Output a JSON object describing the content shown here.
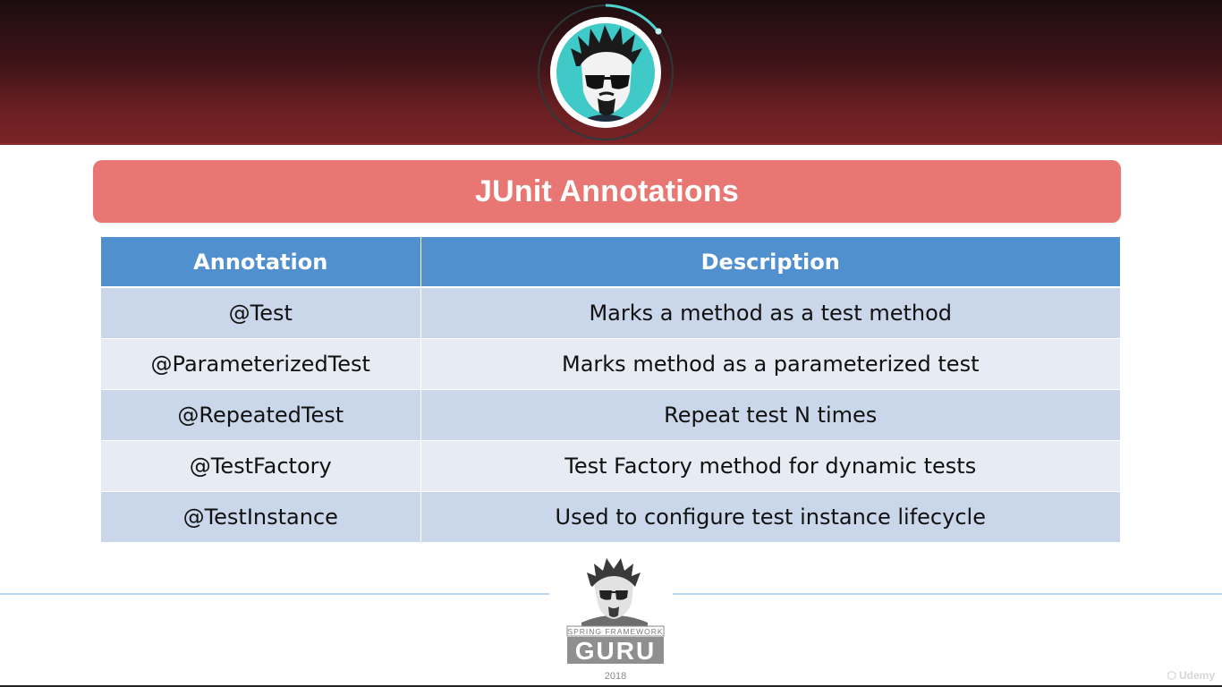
{
  "slide": {
    "title": "JUnit Annotations"
  },
  "table": {
    "headers": [
      "Annotation",
      "Description"
    ],
    "rows": [
      {
        "annotation": "@Test",
        "description": "Marks a method as a test method"
      },
      {
        "annotation": "@ParameterizedTest",
        "description": "Marks method as a parameterized test"
      },
      {
        "annotation": "@RepeatedTest",
        "description": "Repeat test N times"
      },
      {
        "annotation": "@TestFactory",
        "description": "Test Factory method for dynamic tests"
      },
      {
        "annotation": "@TestInstance",
        "description": "Used to configure test instance lifecycle"
      }
    ]
  },
  "footer": {
    "logo_text_top": "SPRING FRAMEWORK",
    "logo_text_main": "GURU",
    "year": "2018",
    "watermark": "Udemy"
  },
  "colors": {
    "header_band": "#6a1f22",
    "title_banner": "#e87773",
    "table_header": "#5190cf",
    "row_odd": "#cad7ea",
    "row_even": "#e6ebf4",
    "avatar_ring": "#3fc9c7"
  },
  "icons": {
    "header_avatar": "guru-avatar-icon",
    "footer_logo": "spring-framework-guru-logo"
  }
}
